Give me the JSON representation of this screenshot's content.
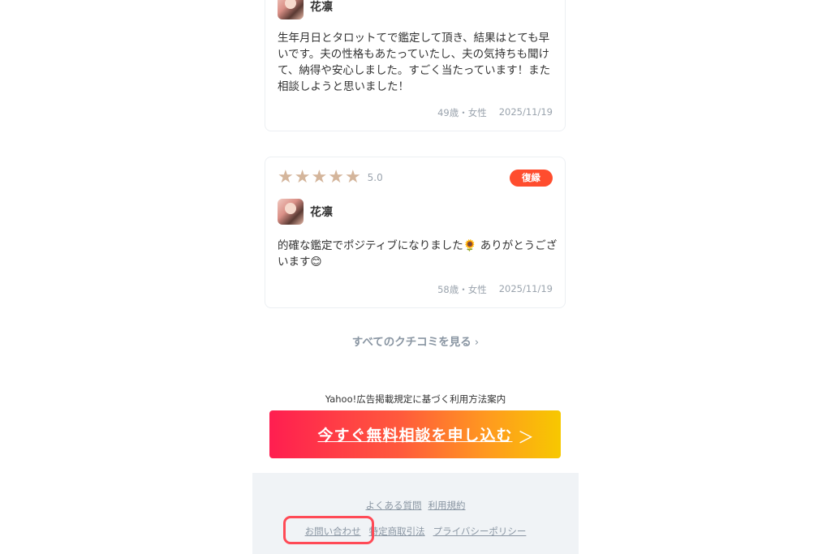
{
  "reviews": [
    {
      "reviewer_name": "花凛",
      "text": "生年月日とタロットてで鑑定して頂き、結果はとても早いです。夫の性格もあたっていたし、夫の気持ちも聞けて、納得や安心しました。すごく当たっています！また相談しようと思いました！",
      "age_gender": "49歳・女性",
      "date": "2025/11/19"
    },
    {
      "stars": 5,
      "rating": "5.0",
      "badge": "復縁",
      "reviewer_name": "花凛",
      "text": "的確な鑑定でポジティブになりました🌻 ありがとうございます😊",
      "age_gender": "58歳・女性",
      "date": "2025/11/19"
    }
  ],
  "more_reviews_label": "すべてのクチコミを見る",
  "yahoo_note": "Yahoo!広告掲載規定に基づく利用方法案内",
  "cta": {
    "label": "今すぐ無料相談を申し込む",
    "arrow": "＞"
  },
  "footer": {
    "faq": "よくある質問",
    "terms": "利用規約",
    "inquiry": "お問い合わせ",
    "commerce": "特定商取引法",
    "privacy": "プライバシーポリシー"
  },
  "colors": {
    "star": "#d4b59b",
    "badge": "#ff4d2e",
    "cta_start": "#ff1e50",
    "cta_end": "#f7c800",
    "highlight": "#ff4a56"
  }
}
